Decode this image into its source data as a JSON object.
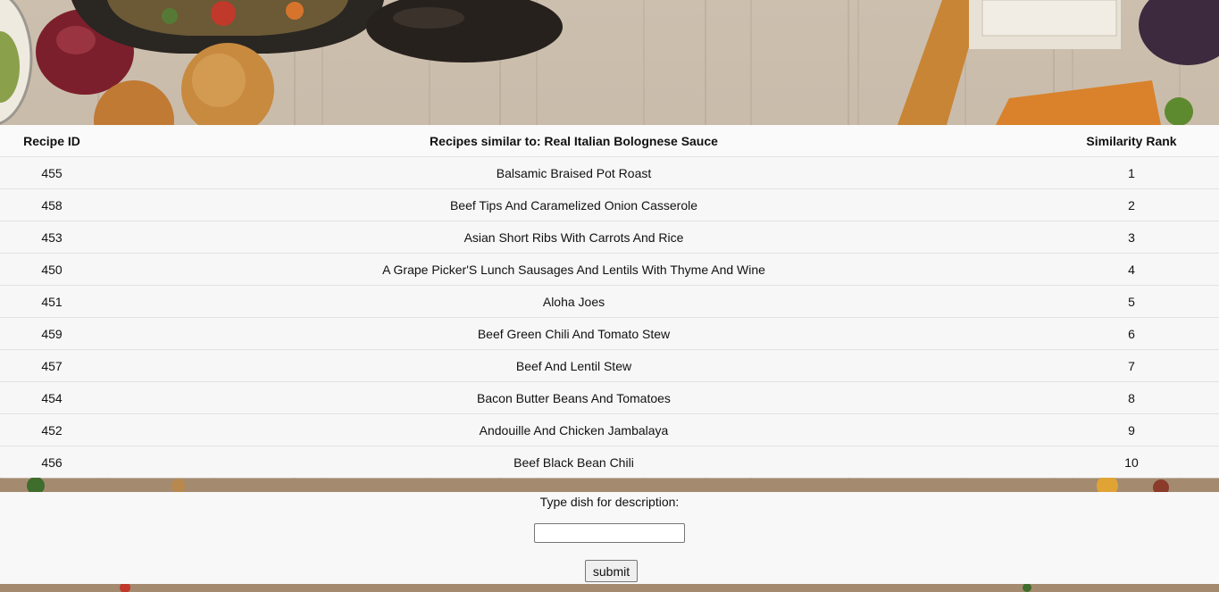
{
  "table": {
    "headers": {
      "id": "Recipe ID",
      "title": "Recipes similar to: Real Italian Bolognese Sauce",
      "rank": "Similarity Rank"
    },
    "rows": [
      {
        "id": "455",
        "name": "Balsamic Braised Pot Roast",
        "rank": "1"
      },
      {
        "id": "458",
        "name": "Beef Tips And Caramelized Onion Casserole",
        "rank": "2"
      },
      {
        "id": "453",
        "name": "Asian Short Ribs With Carrots And Rice",
        "rank": "3"
      },
      {
        "id": "450",
        "name": "A Grape Picker'S Lunch Sausages And Lentils With Thyme And Wine",
        "rank": "4"
      },
      {
        "id": "451",
        "name": "Aloha Joes",
        "rank": "5"
      },
      {
        "id": "459",
        "name": "Beef Green Chili And Tomato Stew",
        "rank": "6"
      },
      {
        "id": "457",
        "name": "Beef And Lentil Stew",
        "rank": "7"
      },
      {
        "id": "454",
        "name": "Bacon Butter Beans And Tomatoes",
        "rank": "8"
      },
      {
        "id": "452",
        "name": "Andouille And Chicken Jambalaya",
        "rank": "9"
      },
      {
        "id": "456",
        "name": "Beef Black Bean Chili",
        "rank": "10"
      }
    ]
  },
  "form": {
    "label": "Type dish for description:",
    "input_value": "",
    "submit_label": "submit"
  }
}
